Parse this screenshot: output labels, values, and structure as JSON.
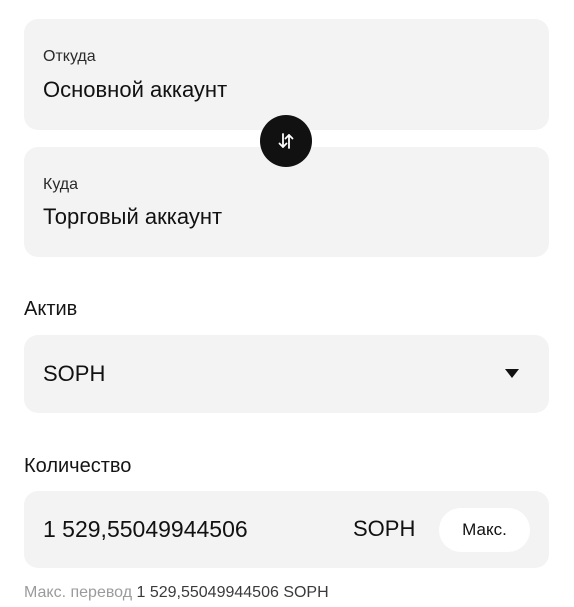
{
  "from": {
    "label": "Откуда",
    "value": "Основной аккаунт"
  },
  "to": {
    "label": "Куда",
    "value": "Торговый аккаунт"
  },
  "swap": {
    "icon": "swap-vertical-arrows-icon"
  },
  "asset": {
    "label": "Актив",
    "selected": "SOPH",
    "dropdown_icon": "chevron-down-icon"
  },
  "quantity": {
    "label": "Количество",
    "value": "1 529,55049944506",
    "unit": "SOPH",
    "max_label": "Макс."
  },
  "max_transfer": {
    "label": "Макс. перевод",
    "value": "1 529,55049944506 SOPH"
  },
  "colors": {
    "field_background": "#f3f3f3",
    "swap_button": "#111111",
    "hint_text": "#9b9b9b"
  }
}
